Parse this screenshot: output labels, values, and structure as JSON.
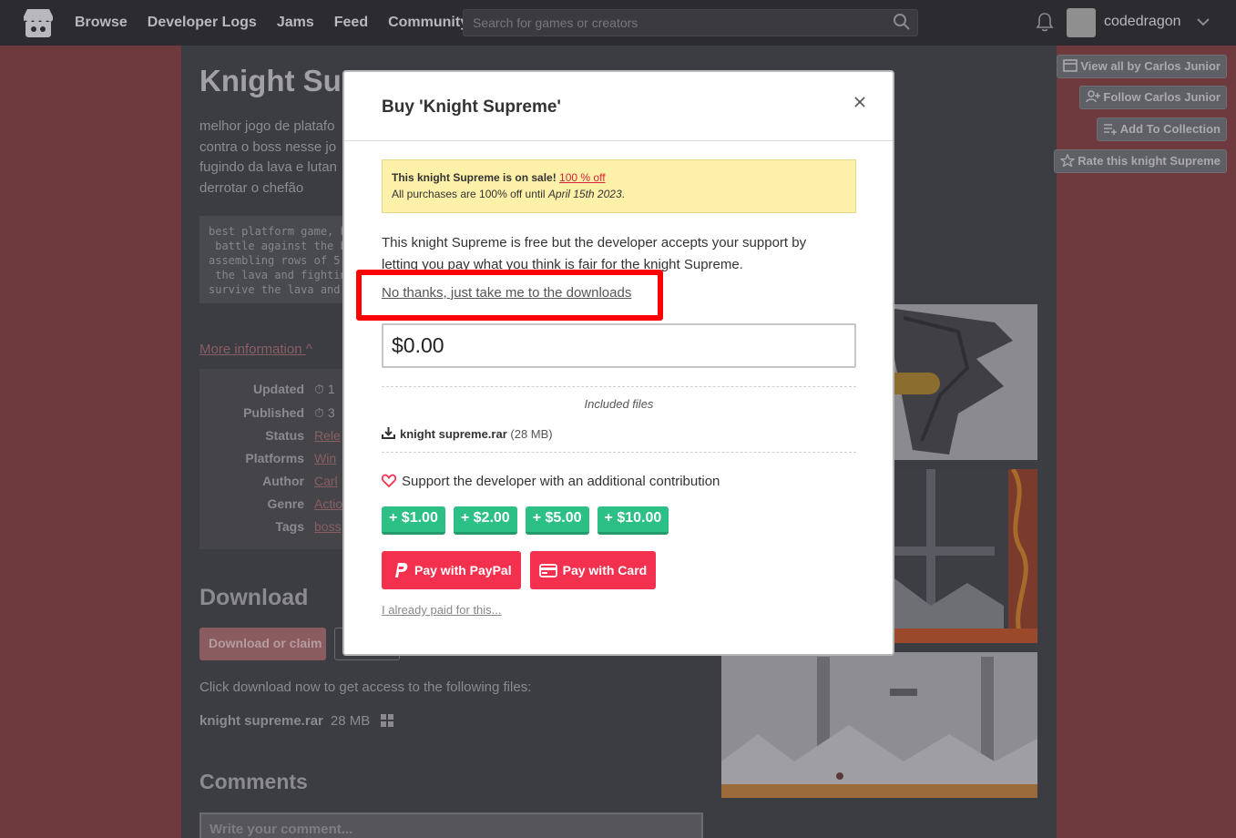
{
  "nav": {
    "links": [
      "Browse",
      "Developer Logs",
      "Jams",
      "Feed",
      "Community"
    ],
    "search_placeholder": "Search for games or creators",
    "username": "codedragon"
  },
  "rail": {
    "view_all": "View all by Carlos Junior",
    "follow": "Follow Carlos Junior",
    "add_collection": "Add To Collection",
    "rate": "Rate this knight Supreme"
  },
  "game": {
    "title": "Knight Sup",
    "description": "melhor jogo de platafo contra o boss nesse jo fugindo da lava e lutan derrotar o chefão",
    "code": "best platform game, h\n battle against the b\nassembling rows of 5\n the lava and fightin\nsurvive the lava and",
    "more_info": "More information",
    "info": [
      {
        "k": "Updated",
        "v": "1"
      },
      {
        "k": "Published",
        "v": "3"
      },
      {
        "k": "Status",
        "v": "Rele"
      },
      {
        "k": "Platforms",
        "v": "Win"
      },
      {
        "k": "Author",
        "v": "Carl"
      },
      {
        "k": "Genre",
        "v": "Actio"
      },
      {
        "k": "Tags",
        "v": "boss"
      }
    ],
    "download_heading": "Download",
    "download_button": "Download or claim",
    "click_download": "Click download now to get access to the following files:",
    "file_name": "knight supreme.rar",
    "file_size": "28 MB",
    "comments_heading": "Comments",
    "comment_placeholder": "Write your comment..."
  },
  "modal": {
    "title": "Buy 'Knight Supreme'",
    "sale_prefix": "This knight Supreme is on sale!",
    "sale_link": "100 % off",
    "sale_line2_prefix": "All purchases are 100% off until",
    "sale_date": "April 15th 2023",
    "sale_line2_suffix": ".",
    "free_text": "This knight Supreme is free but the developer accepts your support by letting you pay what you think is fair for the knight Supreme.",
    "no_thanks": "No thanks, just take me to the downloads",
    "price": "$0.00",
    "included_files": "Included files",
    "file_name": "knight supreme.rar",
    "file_size": "(28 MB)",
    "support": "Support the developer with an additional contribution",
    "tips": [
      "$1.00",
      "$2.00",
      "$5.00",
      "$10.00"
    ],
    "pay_paypal": "Pay with PayPal",
    "pay_card": "Pay with Card",
    "already_paid": "I already paid for this..."
  },
  "colors": {
    "accent_red": "#f4304f",
    "tip_green": "#2cbf86",
    "highlight": "#ff0000",
    "sale_bg": "#fdf0a8"
  }
}
